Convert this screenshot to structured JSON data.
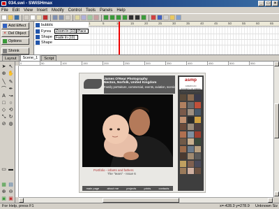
{
  "app": {
    "title": "034.swi - SWiSHmax"
  },
  "window_buttons": [
    "_",
    "□",
    "×"
  ],
  "menu": [
    "File",
    "Edit",
    "View",
    "Insert",
    "Modify",
    "Control",
    "Tools",
    "Panels",
    "Help"
  ],
  "timeline": {
    "buttons": [
      "Add Effect",
      "Del Object",
      "Options"
    ],
    "shrink_label": "Shrink",
    "rows": [
      "bubblicon",
      "Fyrea",
      "Shape",
      "Shape"
    ],
    "ruler_ticks": [
      "1",
      "5",
      "10",
      "15",
      "20",
      "25",
      "30",
      "35",
      "40",
      "45",
      "50",
      "55",
      "60",
      "65",
      "70"
    ],
    "effects": [
      "Zoom In (10)",
      "Fade In (10)",
      "Place"
    ]
  },
  "tabs": [
    "Layout",
    "Scene_1",
    "Script"
  ],
  "site": {
    "header_lines": [
      "James O'Rear Photography",
      "Necton, Norfolk, United Kingdom",
      "Family portraiture, commercial, events, aviation, scenic"
    ],
    "caption": "Portfolio - infants and fathers",
    "caption_sub": "The \"tears\" - Issue 6",
    "nav": [
      "main page",
      "about me",
      "projects",
      "prints",
      "contacts"
    ],
    "badge_title": "asmp",
    "badge_sub": "AMERICAN SOCIETY OF MEDIA PHOTOGRAPHERS"
  },
  "status": {
    "help": "For Help, press F1",
    "coords": "x=-428.3 y=278.9",
    "zoom": "Unknown Siz"
  },
  "colors": {
    "titlebar": "#0a246a",
    "chrome": "#d4d0c8",
    "accent": "#b01010"
  }
}
